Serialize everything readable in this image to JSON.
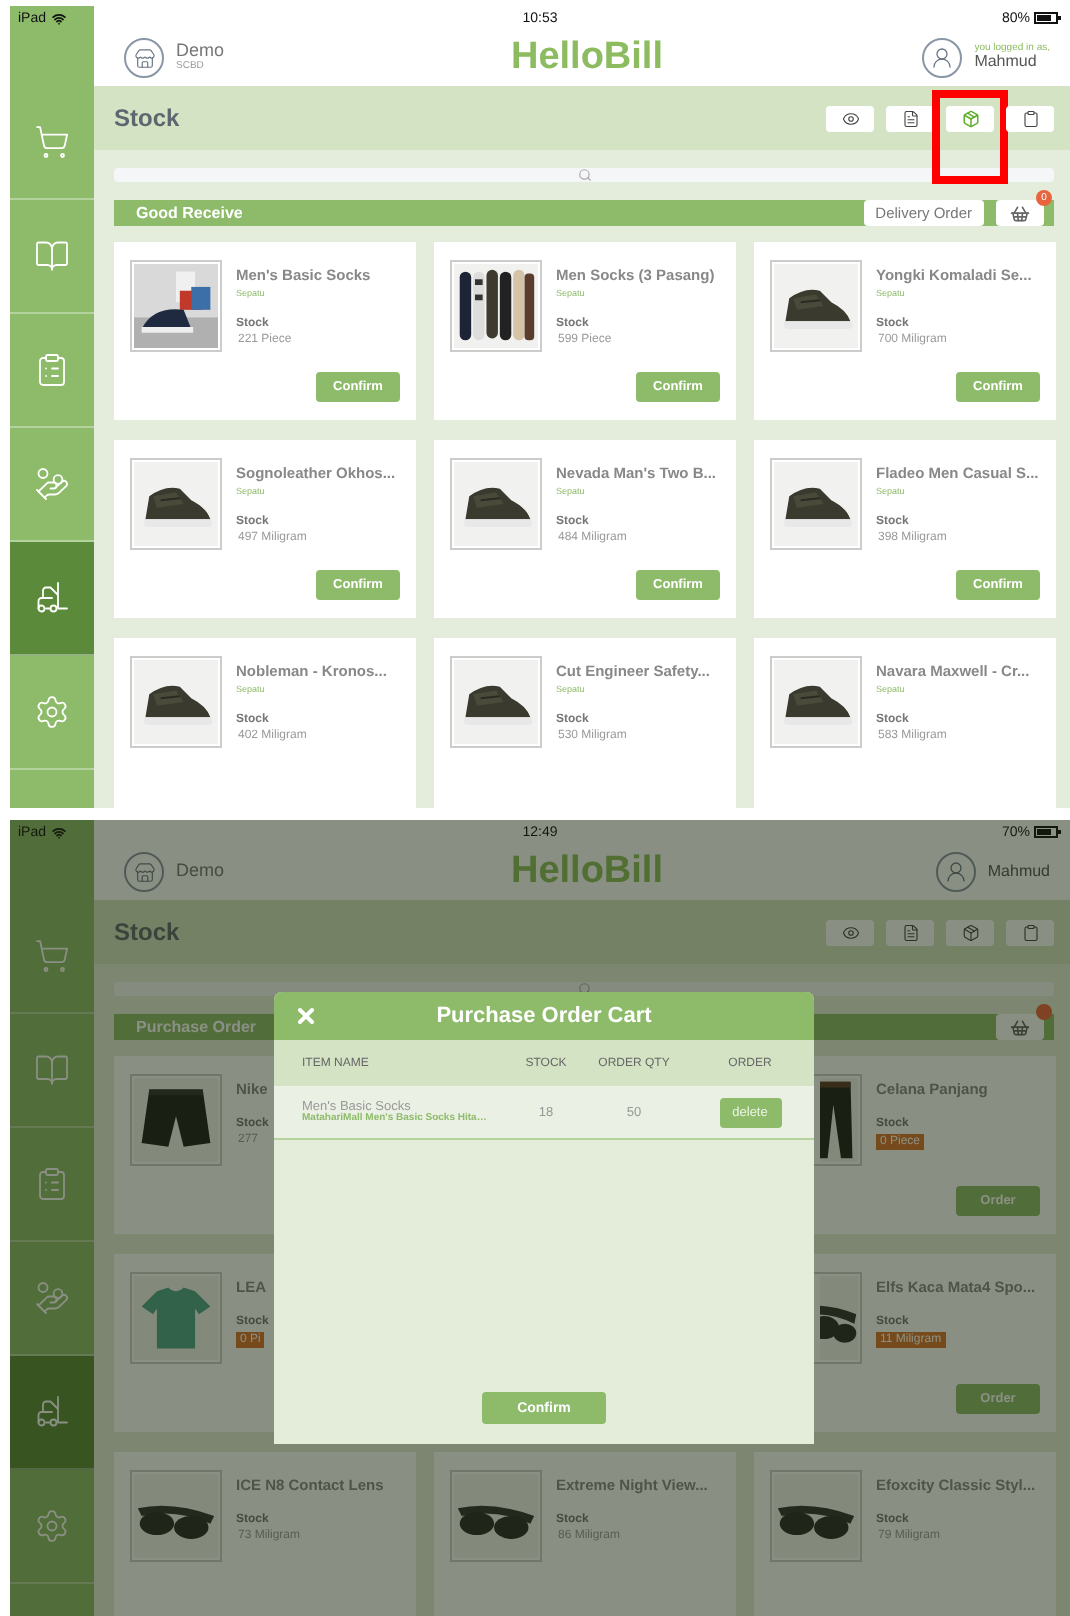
{
  "screens": [
    {
      "status": {
        "carrier": "iPad",
        "time": "10:53",
        "battery": "80%"
      },
      "store": {
        "name": "Demo",
        "branch": "SCBD"
      },
      "app_title": "HelloBill",
      "user": {
        "caption": "you logged in as,",
        "name": "Mahmud"
      },
      "sidebar": [
        {
          "selected": false
        },
        {
          "selected": false
        },
        {
          "selected": false
        },
        {
          "selected": false
        },
        {
          "selected": true
        },
        {
          "selected": false
        }
      ],
      "page_title": "Stock",
      "toolbar": [
        {
          "highlighted": false
        },
        {
          "highlighted": false
        },
        {
          "highlighted": true
        },
        {
          "highlighted": false
        }
      ],
      "group": {
        "title": "Good Receive",
        "delivery_button": "Delivery Order",
        "cart_count": "0"
      },
      "products": [
        {
          "name": "Men's Basic Socks",
          "category": "Sepatu",
          "stock_label": "Stock",
          "stock": "221 Piece",
          "low_stock": false,
          "button": "Confirm"
        },
        {
          "name": "Men Socks (3 Pasang)",
          "category": "Sepatu",
          "stock_label": "Stock",
          "stock": "599 Piece",
          "low_stock": false,
          "button": "Confirm"
        },
        {
          "name": "Yongki Komaladi Se...",
          "category": "Sepatu",
          "stock_label": "Stock",
          "stock": "700 Miligram",
          "low_stock": false,
          "button": "Confirm"
        },
        {
          "name": "Sognoleather Okhos...",
          "category": "Sepatu",
          "stock_label": "Stock",
          "stock": "497 Miligram",
          "low_stock": false,
          "button": "Confirm"
        },
        {
          "name": "Nevada Man's Two B...",
          "category": "Sepatu",
          "stock_label": "Stock",
          "stock": "484 Miligram",
          "low_stock": false,
          "button": "Confirm"
        },
        {
          "name": "Fladeo Men Casual S...",
          "category": "Sepatu",
          "stock_label": "Stock",
          "stock": "398 Miligram",
          "low_stock": false,
          "button": "Confirm"
        },
        {
          "name": "Nobleman - Kronos...",
          "category": "Sepatu",
          "stock_label": "Stock",
          "stock": "402 Miligram",
          "low_stock": false
        },
        {
          "name": "Cut Engineer Safety...",
          "category": "Sepatu",
          "stock_label": "Stock",
          "stock": "530 Miligram",
          "low_stock": false
        },
        {
          "name": "Navara Maxwell - Cr...",
          "category": "Sepatu",
          "stock_label": "Stock",
          "stock": "583 Miligram",
          "low_stock": false
        }
      ]
    },
    {
      "status": {
        "carrier": "iPad",
        "time": "12:49",
        "battery": "70%"
      },
      "store": {
        "name": "Demo"
      },
      "app_title": "HelloBill",
      "user": {
        "name": "Mahmud"
      },
      "sidebar": [
        {
          "selected": false
        },
        {
          "selected": false
        },
        {
          "selected": false
        },
        {
          "selected": false
        },
        {
          "selected": true
        },
        {
          "selected": false
        }
      ],
      "page_title": "Stock",
      "toolbar": [
        {
          "highlighted": false
        },
        {
          "highlighted": false
        },
        {
          "highlighted": false
        },
        {
          "highlighted": false
        }
      ],
      "group": {
        "title": "Purchase Order"
      },
      "products": [
        {
          "name": "Nike",
          "stock_label": "Stock",
          "stock": "277",
          "low_stock": false
        },
        {
          "name": "Celana Panjang",
          "stock_label": "Stock",
          "stock": "0 Piece",
          "low_stock": true,
          "button": "Order"
        },
        {
          "name": "LEA",
          "stock_label": "Stock",
          "stock": "0 Pi",
          "low_stock": true
        },
        {
          "name": "Elfs Kaca Mata4 Spo...",
          "stock_label": "Stock",
          "stock": "11 Miligram",
          "low_stock": true,
          "button": "Order"
        },
        {
          "name": "ICE N8 Contact Lens",
          "stock_label": "Stock",
          "stock": "73 Miligram",
          "low_stock": false
        },
        {
          "name": "Extreme Night View...",
          "stock_label": "Stock",
          "stock": "86 Miligram",
          "low_stock": false
        },
        {
          "name": "Efoxcity Classic Styl...",
          "stock_label": "Stock",
          "stock": "79 Miligram",
          "low_stock": false
        }
      ],
      "modal": {
        "title": "Purchase Order Cart",
        "columns": [
          "ITEM NAME",
          "STOCK",
          "ORDER QTY",
          "ORDER"
        ],
        "rows": [
          {
            "name": "Men's Basic Socks",
            "detail": "MatahariMall Men's Basic Socks Hita…",
            "stock": "18",
            "qty": "50",
            "action": "delete"
          }
        ],
        "confirm": "Confirm"
      }
    }
  ]
}
